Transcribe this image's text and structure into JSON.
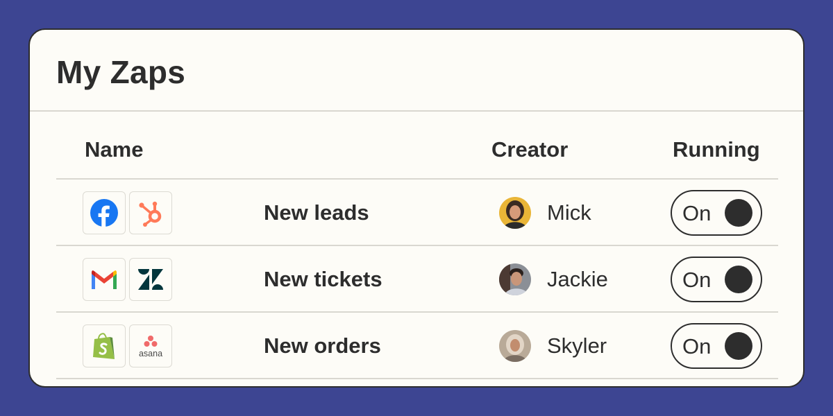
{
  "header": {
    "title": "My Zaps"
  },
  "table": {
    "columns": {
      "name": "Name",
      "creator": "Creator",
      "running": "Running"
    },
    "rows": [
      {
        "apps": [
          "facebook-icon",
          "hubspot-icon"
        ],
        "name": "New leads",
        "creator": "Mick",
        "running": "On"
      },
      {
        "apps": [
          "gmail-icon",
          "zendesk-icon"
        ],
        "name": "New tickets",
        "creator": "Jackie",
        "running": "On"
      },
      {
        "apps": [
          "shopify-icon",
          "asana-icon"
        ],
        "name": "New orders",
        "creator": "Skyler",
        "running": "On"
      }
    ]
  },
  "logos": {
    "asana_wordmark": "asana"
  },
  "colors": {
    "background": "#3d4592",
    "card": "#fdfcf7",
    "text": "#2d2d2d",
    "divider": "#d9d7d0",
    "facebook": "#1877f2",
    "hubspot": "#ff7a59",
    "zendesk": "#03363d",
    "shopify": "#95bf47",
    "asana": "#f06a6a"
  }
}
